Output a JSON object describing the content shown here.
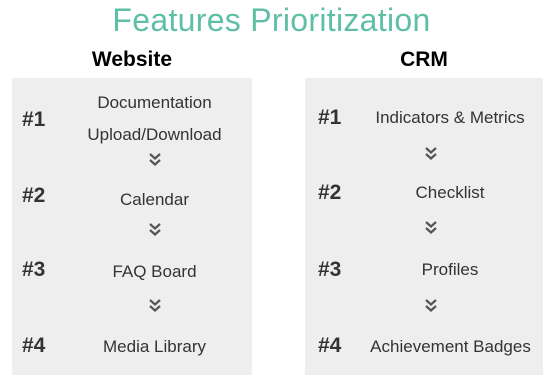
{
  "title": "Features Prioritization",
  "columns": [
    {
      "heading": "Website",
      "items": [
        {
          "rank": "#1",
          "label_line1": "Documentation",
          "label_line2": "Upload/Download"
        },
        {
          "rank": "#2",
          "label": "Calendar"
        },
        {
          "rank": "#3",
          "label": "FAQ Board"
        },
        {
          "rank": "#4",
          "label": "Media Library"
        }
      ]
    },
    {
      "heading": "CRM",
      "items": [
        {
          "rank": "#1",
          "label": "Indicators & Metrics"
        },
        {
          "rank": "#2",
          "label": "Checklist"
        },
        {
          "rank": "#3",
          "label": "Profiles"
        },
        {
          "rank": "#4",
          "label": "Achievement Badges"
        }
      ]
    }
  ],
  "colors": {
    "title": "#5ebfa5",
    "panel": "#eeeeee",
    "text": "#333333",
    "chevron": "#555555"
  },
  "icons": [
    "double-chevron-down-icon"
  ]
}
